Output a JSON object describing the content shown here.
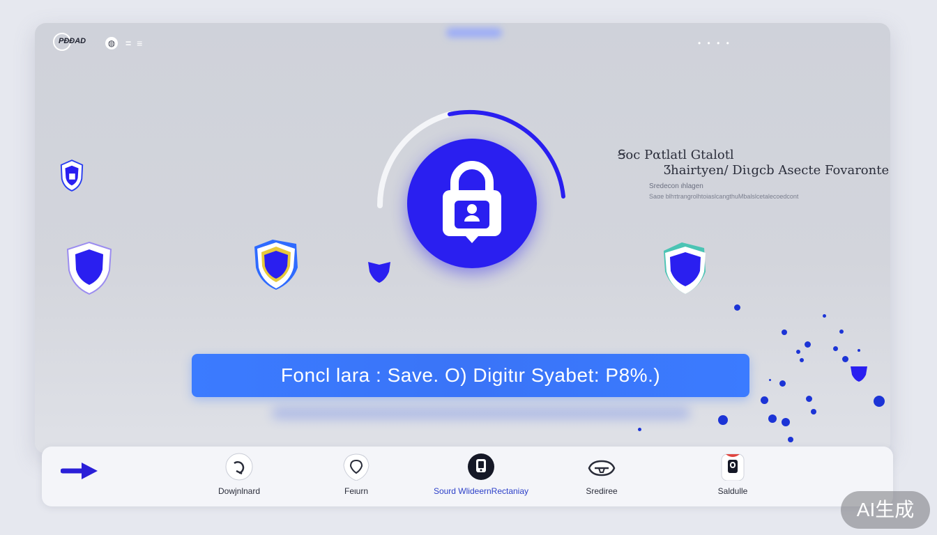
{
  "header": {
    "brand_text": "PƉƉAD",
    "globe_icon": "globe-icon",
    "menu_glyph": "= ≡",
    "window_dots": "• • • •"
  },
  "hero": {
    "icon": "lock-icon",
    "accent_color": "#2a1ff0",
    "ring_progress": 0.72
  },
  "info": {
    "title_line1": "Ꞩoc   Pαtlatl Gtalotl",
    "title_line2": "Ʒhairtyen/ Diιgcb Asecte Fovaronte",
    "sub_line1": "Sredecon ιhlagen",
    "sub_line2": "Saαe blhτtrangrolhtoiaslcangthuMbalslcetalecoedcont"
  },
  "banner": {
    "text": "Foncl lara   : Save. O) Digitιr Syabet: P8%.)",
    "color": "#3b7bff"
  },
  "bottom_nav": {
    "items": [
      {
        "label": "Dowjnlnard",
        "icon": "refresh-icon"
      },
      {
        "label": "Feιurn",
        "icon": "location-pin-icon"
      },
      {
        "label": "Sourd WlideernRectaniay",
        "icon": "mobile-phone-icon",
        "active": true
      },
      {
        "label": "Srediree",
        "icon": "helmet-icon"
      },
      {
        "label": "Saldulle",
        "icon": "key-card-icon"
      }
    ]
  },
  "badge": {
    "text": "AI生成"
  }
}
